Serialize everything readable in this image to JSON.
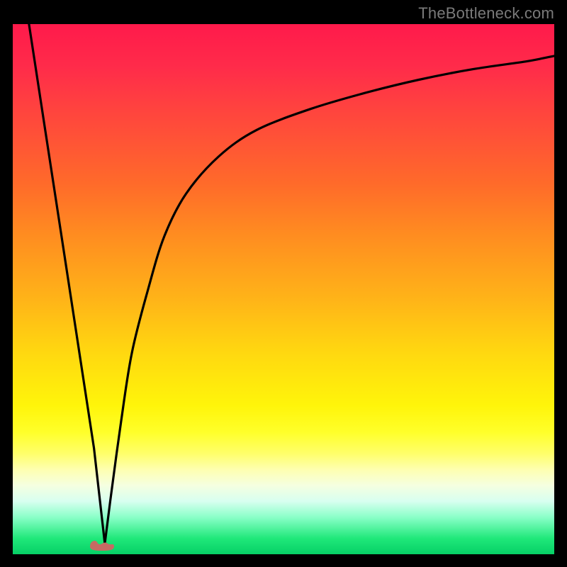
{
  "attribution": "TheBottleneck.com",
  "colors": {
    "gradient_top": "#ff1a4b",
    "gradient_bottom": "#06d066",
    "curve": "#000000",
    "blob": "#c66a63",
    "frame": "#000000"
  },
  "chart_data": {
    "type": "line",
    "title": "",
    "xlabel": "",
    "ylabel": "",
    "xlim": [
      0,
      100
    ],
    "ylim": [
      0,
      100
    ],
    "grid": false,
    "legend": false,
    "series": [
      {
        "name": "left-descent",
        "x": [
          3,
          6,
          9,
          12,
          15,
          17
        ],
        "values": [
          100,
          80,
          60,
          40,
          20,
          2
        ]
      },
      {
        "name": "right-ascent",
        "x": [
          17,
          18,
          20,
          22,
          25,
          28,
          32,
          38,
          45,
          55,
          65,
          75,
          85,
          95,
          100
        ],
        "values": [
          2,
          10,
          25,
          38,
          50,
          60,
          68,
          75,
          80,
          84,
          87,
          89.5,
          91.5,
          93,
          94
        ]
      }
    ],
    "annotations": [
      {
        "name": "min-blob",
        "x": 16.5,
        "y": 2,
        "shape": "rounded-bean",
        "color": "#c66a63"
      }
    ]
  }
}
